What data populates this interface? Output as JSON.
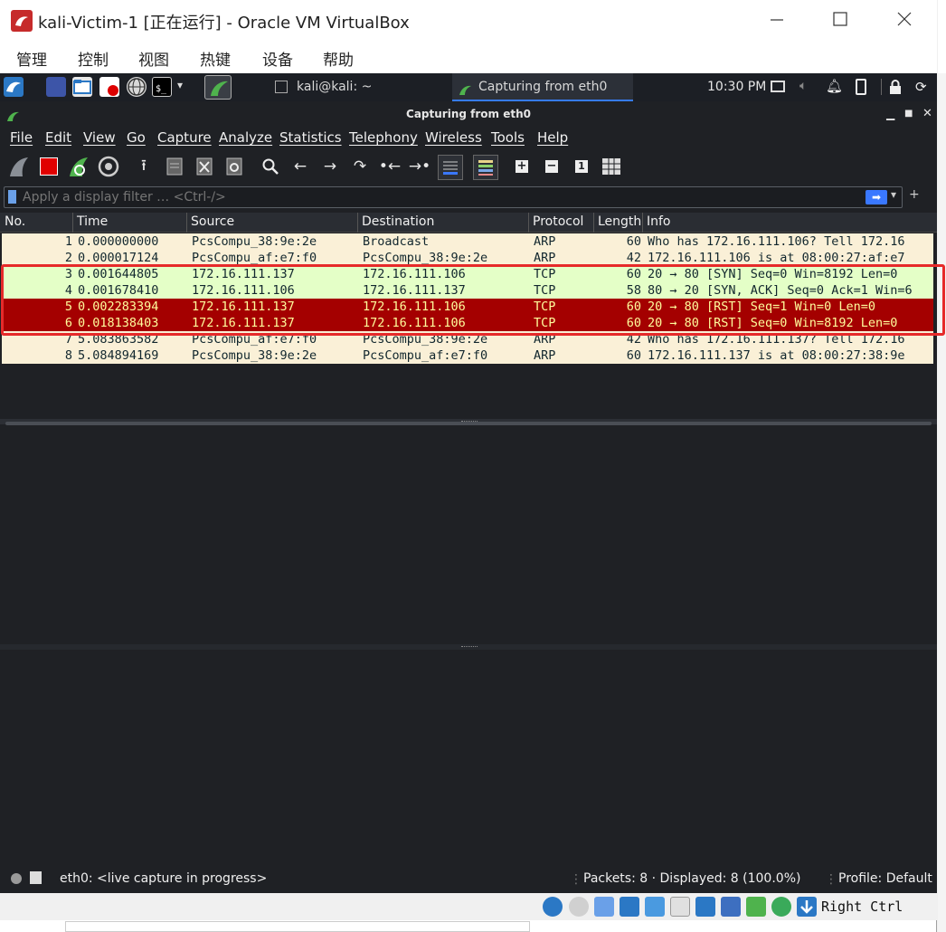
{
  "vbox": {
    "title": "kali-Victim-1 [正在运行] - Oracle VM VirtualBox",
    "menu": [
      "管理",
      "控制",
      "视图",
      "热键",
      "设备",
      "帮助"
    ],
    "right_ctrl": "Right Ctrl"
  },
  "panel": {
    "task_terminal": "kali@kali: ~",
    "task_wireshark": "Capturing from eth0",
    "clock": "10:30 PM"
  },
  "wireshark": {
    "title": "Capturing from eth0",
    "menu": [
      "File",
      "Edit",
      "View",
      "Go",
      "Capture",
      "Analyze",
      "Statistics",
      "Telephony",
      "Wireless",
      "Tools",
      "Help"
    ],
    "filter_placeholder": "Apply a display filter … <Ctrl-/>",
    "columns": [
      "No.",
      "Time",
      "Source",
      "Destination",
      "Protocol",
      "Length",
      "Info"
    ],
    "packets": [
      {
        "no": "1",
        "time": "0.000000000",
        "src": "PcsCompu_38:9e:2e",
        "dst": "Broadcast",
        "proto": "ARP",
        "len": "60",
        "info": "Who has 172.16.111.106? Tell 172.16",
        "style": "arp"
      },
      {
        "no": "2",
        "time": "0.000017124",
        "src": "PcsCompu_af:e7:f0",
        "dst": "PcsCompu_38:9e:2e",
        "proto": "ARP",
        "len": "42",
        "info": "172.16.111.106 is at 08:00:27:af:e7",
        "style": "arp"
      },
      {
        "no": "3",
        "time": "0.001644805",
        "src": "172.16.111.137",
        "dst": "172.16.111.106",
        "proto": "TCP",
        "len": "60",
        "info": "20 → 80 [SYN] Seq=0 Win=8192 Len=0",
        "style": "tcp"
      },
      {
        "no": "4",
        "time": "0.001678410",
        "src": "172.16.111.106",
        "dst": "172.16.111.137",
        "proto": "TCP",
        "len": "58",
        "info": "80 → 20 [SYN, ACK] Seq=0 Ack=1 Win=6",
        "style": "tcp"
      },
      {
        "no": "5",
        "time": "0.002283394",
        "src": "172.16.111.137",
        "dst": "172.16.111.106",
        "proto": "TCP",
        "len": "60",
        "info": "20 → 80 [RST] Seq=1 Win=0 Len=0",
        "style": "rst"
      },
      {
        "no": "6",
        "time": "0.018138403",
        "src": "172.16.111.137",
        "dst": "172.16.111.106",
        "proto": "TCP",
        "len": "60",
        "info": "20 → 80 [RST] Seq=0 Win=8192 Len=0",
        "style": "rst"
      },
      {
        "no": "7",
        "time": "5.083863582",
        "src": "PcsCompu_af:e7:f0",
        "dst": "PcsCompu_38:9e:2e",
        "proto": "ARP",
        "len": "42",
        "info": "Who has 172.16.111.137? Tell 172.16",
        "style": "arp"
      },
      {
        "no": "8",
        "time": "5.084894169",
        "src": "PcsCompu_38:9e:2e",
        "dst": "PcsCompu_af:e7:f0",
        "proto": "ARP",
        "len": "60",
        "info": "172.16.111.137 is at 08:00:27:38:9e",
        "style": "arp"
      }
    ],
    "status": {
      "capture": "eth0: <live capture in progress>",
      "packets": "Packets: 8 · Displayed: 8 (100.0%)",
      "profile": "Profile: Default"
    }
  },
  "colors": {
    "arp_bg": "#faf0d7",
    "tcp_bg": "#e7e6ff",
    "syn_bg": "#e4ffc7",
    "rst_bg": "#a40000",
    "rst_fg": "#fffc9c",
    "highlight": "#e62a2a",
    "ws_bg": "#1f2125"
  }
}
